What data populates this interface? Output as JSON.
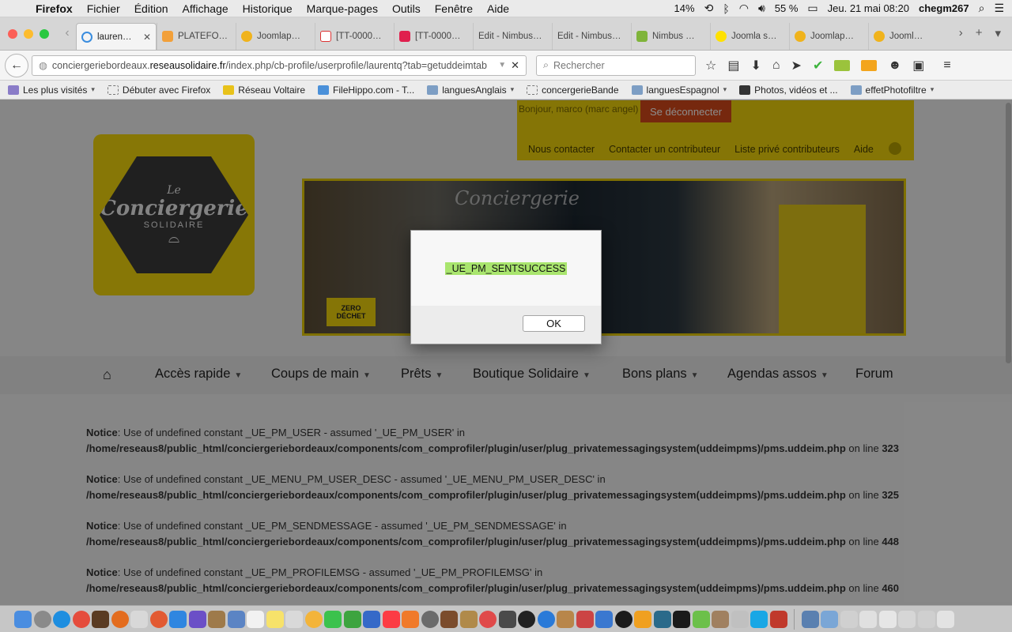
{
  "menubar": {
    "app": "Firefox",
    "items": [
      "Fichier",
      "Édition",
      "Affichage",
      "Historique",
      "Marque-pages",
      "Outils",
      "Fenêtre",
      "Aide"
    ],
    "status": {
      "percent_left": "14%",
      "battery": "55 %",
      "datetime": "Jeu. 21 mai  08:20",
      "user": "chegm267"
    }
  },
  "tabs": [
    {
      "title": "lauren…",
      "active": true
    },
    {
      "title": "PLATEFO…"
    },
    {
      "title": "Joomlap…"
    },
    {
      "title": "[TT-0000…"
    },
    {
      "title": "[TT-0000…"
    },
    {
      "title": "Edit - Nimbus…"
    },
    {
      "title": "Edit - Nimbus…"
    },
    {
      "title": "Nimbus …"
    },
    {
      "title": "Joomla s…"
    },
    {
      "title": "Joomlap…"
    },
    {
      "title": "Joomlap…"
    }
  ],
  "nav": {
    "url_prefix": "conciergeriebordeaux.",
    "url_domain": "reseausolidaire.fr",
    "url_path": "/index.php/cb-profile/userprofile/laurentq?tab=getuddeimtab",
    "search_placeholder": "Rechercher"
  },
  "bookmarks": [
    {
      "label": "Les plus visités",
      "dropdown": true
    },
    {
      "label": "Débuter avec Firefox"
    },
    {
      "label": "Réseau Voltaire"
    },
    {
      "label": "FileHippo.com - T..."
    },
    {
      "label": "languesAnglais",
      "dropdown": true
    },
    {
      "label": "concergerieBande"
    },
    {
      "label": "languesEspagnol",
      "dropdown": true
    },
    {
      "label": "Photos, vidéos et ..."
    },
    {
      "label": "effetPhotofiltre",
      "dropdown": true
    }
  ],
  "site": {
    "greeting": "Bonjour, marco (marc angel)",
    "logout": "Se déconnecter",
    "top_links": [
      "Nous contacter",
      "Contacter un contributeur",
      "Liste privé contributeurs",
      "Aide"
    ],
    "logo": {
      "le": "Le",
      "name": "Conciergerie",
      "sub": "SOLIDAIRE"
    },
    "banner": {
      "sign": "Conciergerie",
      "zero": "ZERO DÉCHET"
    },
    "menu": [
      {
        "label": "Accès rapide",
        "dropdown": true
      },
      {
        "label": "Coups de main",
        "dropdown": true
      },
      {
        "label": "Prêts",
        "dropdown": true
      },
      {
        "label": "Boutique Solidaire",
        "dropdown": true
      },
      {
        "label": "Bons plans",
        "dropdown": true
      },
      {
        "label": "Agendas assos",
        "dropdown": true
      },
      {
        "label": "Forum",
        "dropdown": false
      }
    ],
    "notices": [
      {
        "prefix": "Notice",
        "text": ": Use of undefined constant _UE_PM_USER - assumed '_UE_PM_USER' in ",
        "path": "/home/reseaus8/public_html/conciergeriebordeaux/components/com_comprofiler/plugin/user/plug_privatemessagingsystem(uddeimpms)/pms.uddeim.php",
        "online": " on line ",
        "line": "323"
      },
      {
        "prefix": "Notice",
        "text": ": Use of undefined constant _UE_MENU_PM_USER_DESC - assumed '_UE_MENU_PM_USER_DESC' in ",
        "path": "/home/reseaus8/public_html/conciergeriebordeaux/components/com_comprofiler/plugin/user/plug_privatemessagingsystem(uddeimpms)/pms.uddeim.php",
        "online": " on line ",
        "line": "325"
      },
      {
        "prefix": "Notice",
        "text": ": Use of undefined constant _UE_PM_SENDMESSAGE - assumed '_UE_PM_SENDMESSAGE' in ",
        "path": "/home/reseaus8/public_html/conciergeriebordeaux/components/com_comprofiler/plugin/user/plug_privatemessagingsystem(uddeimpms)/pms.uddeim.php",
        "online": " on line ",
        "line": "448"
      },
      {
        "prefix": "Notice",
        "text": ": Use of undefined constant _UE_PM_PROFILEMSG - assumed '_UE_PM_PROFILEMSG' in ",
        "path": "/home/reseaus8/public_html/conciergeriebordeaux/components/com_comprofiler/plugin/user/plug_privatemessagingsystem(uddeimpms)/pms.uddeim.php",
        "online": " on line ",
        "line": "460"
      }
    ]
  },
  "dialog": {
    "message": "_UE_PM_SENTSUCCESS",
    "ok": "OK"
  },
  "colors": {
    "accent": "#f2d60c",
    "logout": "#d84a1b",
    "highlight": "#a9e56e"
  }
}
